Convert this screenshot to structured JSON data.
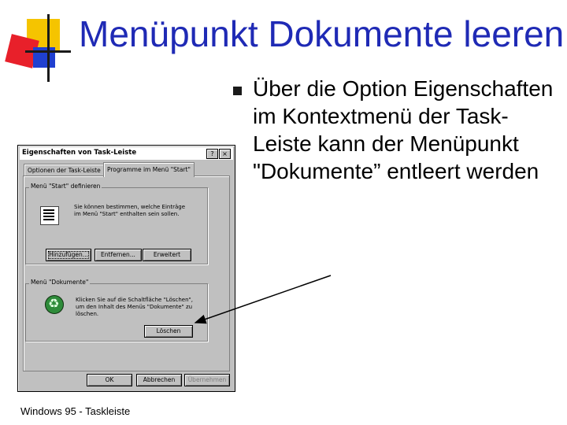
{
  "slide": {
    "title": "Menüpunkt Dokumente leeren",
    "bullet": "Über die Option Eigenschaften im Kontextmenü der Task-Leiste kann der Menüpunkt \"Dokumente” entleert werden",
    "caption": "Windows 95 - Taskleiste"
  },
  "dialog": {
    "title": "Eigenschaften von Task-Leiste",
    "help_label": "?",
    "close_label": "×",
    "tabs": [
      {
        "label": "Optionen der Task-Leiste"
      },
      {
        "label": "Programme im Menü \"Start\""
      }
    ],
    "group_start": {
      "legend": "Menü \"Start\" definieren",
      "description": "Sie können bestimmen, welche Einträge im Menü \"Start\" enthalten sein sollen.",
      "add_label": "Hinzufügen...",
      "remove_label": "Entfernen...",
      "advanced_label": "Erweitert"
    },
    "group_docs": {
      "legend": "Menü \"Dokumente\"",
      "description": "Klicken Sie auf die Schaltfläche \"Löschen\", um den Inhalt des Menüs \"Dokumente\" zu löschen.",
      "clear_label": "Löschen"
    },
    "ok_label": "OK",
    "cancel_label": "Abbrechen",
    "apply_label": "Übernehmen"
  },
  "colors": {
    "title": "#1f2ab5",
    "dialog_face": "#c0c0c0",
    "logo_yellow": "#f5c400",
    "logo_red": "#e8202a",
    "logo_blue": "#2040d0"
  }
}
